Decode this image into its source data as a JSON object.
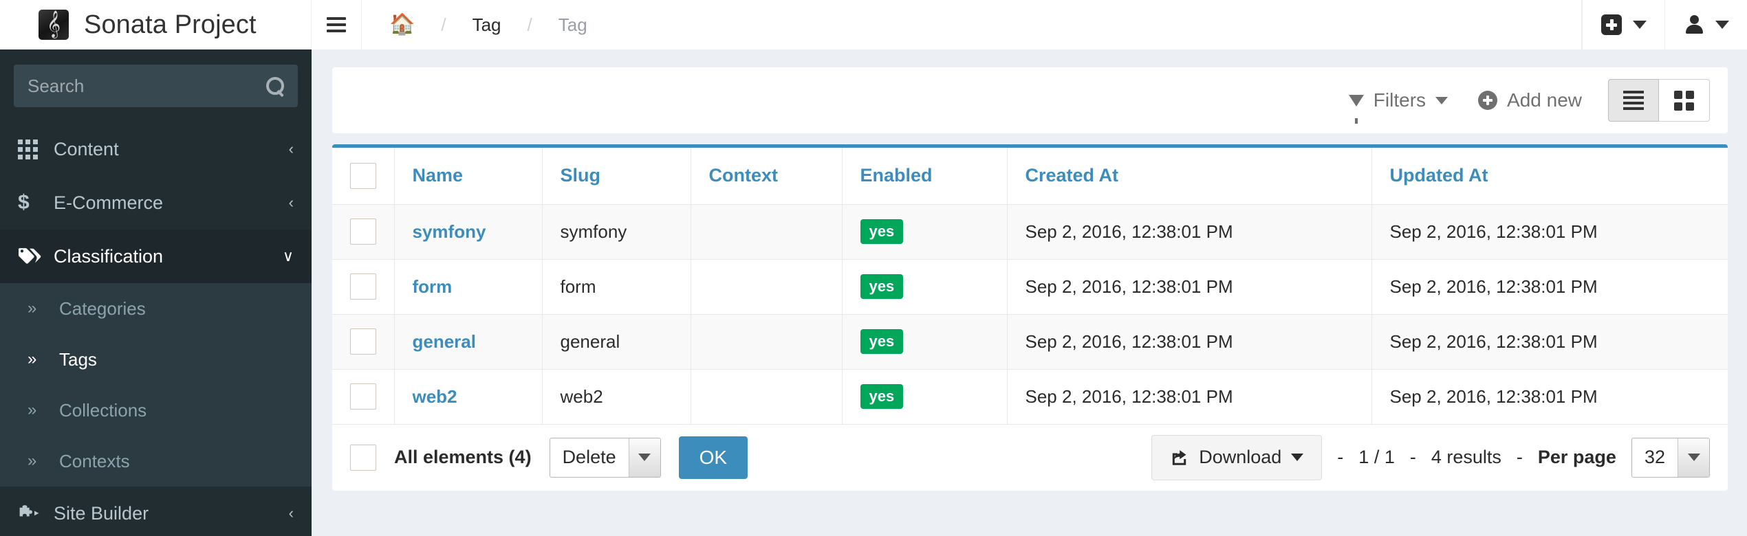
{
  "brand": {
    "title": "Sonata Project",
    "logo_glyph": "\u0001"
  },
  "breadcrumb": {
    "home_icon": "home-icon",
    "items": [
      "Tag",
      "Tag"
    ],
    "separator": "/"
  },
  "topnav": {
    "add_dropdown_icon": "plus-square-icon",
    "user_dropdown_icon": "user-icon"
  },
  "sidebar": {
    "search": {
      "placeholder": "Search",
      "value": "",
      "icon": "search-icon"
    },
    "items": [
      {
        "label": "Content",
        "icon": "grid-icon",
        "chevron": "‹"
      },
      {
        "label": "E-Commerce",
        "icon": "dollar-icon",
        "chevron": "‹"
      },
      {
        "label": "Classification",
        "icon": "tag-icon",
        "chevron": "∨"
      },
      {
        "label": "Site Builder",
        "icon": "puzzle-icon",
        "chevron": "‹"
      }
    ],
    "submenu": [
      {
        "label": "Categories",
        "chevron": "»"
      },
      {
        "label": "Tags",
        "chevron": "»"
      },
      {
        "label": "Collections",
        "chevron": "»"
      },
      {
        "label": "Contexts",
        "chevron": "»"
      }
    ]
  },
  "toolbar": {
    "filters_label": "Filters",
    "add_new_label": "Add new",
    "list_view_icon": "list-view-icon",
    "grid_view_icon": "grid-view-icon"
  },
  "table": {
    "columns": [
      "Name",
      "Slug",
      "Context",
      "Enabled",
      "Created At",
      "Updated At"
    ],
    "rows": [
      {
        "name": "symfony",
        "slug": "symfony",
        "context": "",
        "enabled": "yes",
        "created_at": "Sep 2, 2016, 12:38:01 PM",
        "updated_at": "Sep 2, 2016, 12:38:01 PM"
      },
      {
        "name": "form",
        "slug": "form",
        "context": "",
        "enabled": "yes",
        "created_at": "Sep 2, 2016, 12:38:01 PM",
        "updated_at": "Sep 2, 2016, 12:38:01 PM"
      },
      {
        "name": "general",
        "slug": "general",
        "context": "",
        "enabled": "yes",
        "created_at": "Sep 2, 2016, 12:38:01 PM",
        "updated_at": "Sep 2, 2016, 12:38:01 PM"
      },
      {
        "name": "web2",
        "slug": "web2",
        "context": "",
        "enabled": "yes",
        "created_at": "Sep 2, 2016, 12:38:01 PM",
        "updated_at": "Sep 2, 2016, 12:38:01 PM"
      }
    ]
  },
  "footer": {
    "all_elements_label": "All elements (4)",
    "batch_action_value": "Delete",
    "ok_label": "OK",
    "download_label": "Download",
    "pager_prefix": "-",
    "page_indicator": "1 / 1",
    "results_label": "4 results",
    "per_page_label": "Per page",
    "per_page_value": "32"
  },
  "colors": {
    "accent": "#3c8dbc",
    "sidebar_bg": "#222d32",
    "sidebar_active": "#1e282c",
    "submenu_bg": "#2c3b41",
    "badge_green": "#00a65a",
    "page_bg": "#ecf0f5"
  }
}
